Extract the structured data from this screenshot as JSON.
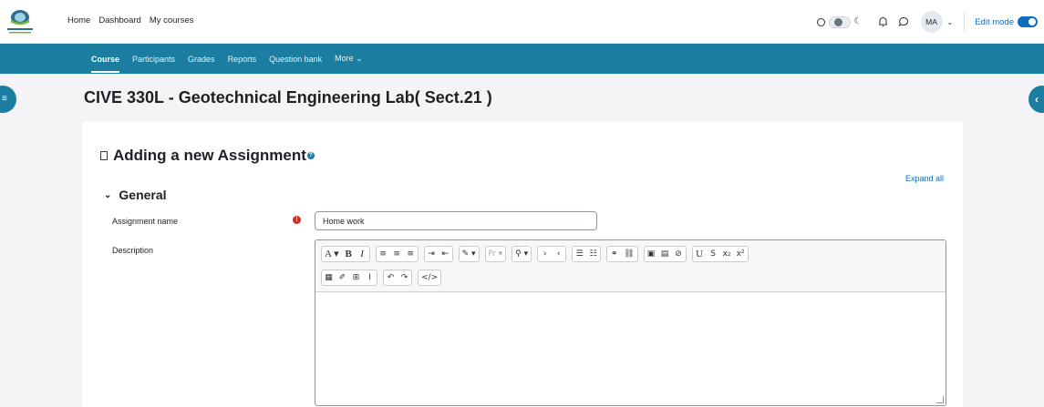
{
  "navbar": {
    "links": [
      "Home",
      "Dashboard",
      "My courses"
    ],
    "avatar_initials": "MA",
    "edit_mode_label": "Edit mode"
  },
  "secondary_nav": {
    "tabs": [
      "Course",
      "Participants",
      "Grades",
      "Reports",
      "Question bank",
      "More ⌄"
    ],
    "active_tab": "Course"
  },
  "page": {
    "course_title": "CIVE 330L - Geotechnical Engineering Lab( Sect.21 )",
    "form_title": "Adding a new Assignment",
    "expand_all": "Expand all",
    "section_title": "General",
    "assignment_name_label": "Assignment name",
    "assignment_name_value": "Home work",
    "description_label": "Description"
  },
  "editor": {
    "toolbar_row1": [
      [
        "A ▾",
        "B",
        "I"
      ],
      [
        "≡",
        "≡",
        "≡"
      ],
      [
        "⇥",
        "⇤"
      ],
      [
        "✎ ▾"
      ],
      [
        "Fr ▾"
      ],
      [
        "⚲ ▾"
      ],
      [
        "›",
        "‹"
      ],
      [
        "☰",
        "☷"
      ],
      [
        "⚭",
        "⛓"
      ],
      [
        "▣",
        "▤",
        "⊘"
      ],
      [
        "U",
        "S",
        "x₂",
        "x²"
      ]
    ],
    "toolbar_row2": [
      [
        "▦",
        "✐",
        "⊞",
        "I"
      ],
      [
        "↶",
        "↷"
      ],
      [
        "</>"
      ]
    ]
  },
  "colors": {
    "brand": "#1b7ea0",
    "link": "#0f6cbf",
    "required": "#ca3120"
  },
  "icons": [
    "logo-icon",
    "sun-icon",
    "moon-icon",
    "bell-icon",
    "chat-icon",
    "doc-icon",
    "help-icon",
    "required-icon",
    "chevron-down-icon"
  ]
}
